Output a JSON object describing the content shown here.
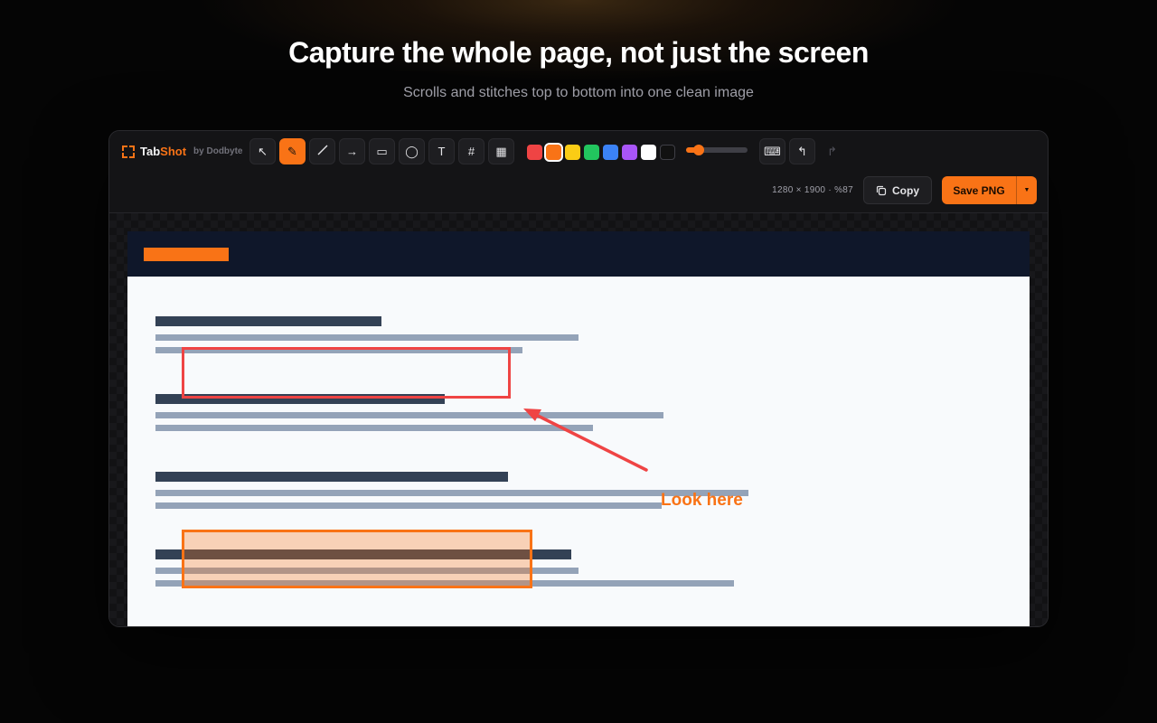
{
  "hero": {
    "title": "Capture the whole page, not just the screen",
    "subtitle": "Scrolls and stitches top to bottom into one clean image"
  },
  "app": {
    "brand": {
      "name_prefix": "Tab",
      "name_accent": "Shot",
      "by": "by Dodbyte",
      "icon": "capture-frame-icon"
    },
    "tools": [
      {
        "name": "select-tool",
        "glyph": "↖",
        "icon": "cursor-icon",
        "active": false
      },
      {
        "name": "pen-tool",
        "glyph": "✎",
        "icon": "pencil-icon",
        "active": true
      },
      {
        "name": "line-tool",
        "glyph": "",
        "icon": "line-icon",
        "active": false
      },
      {
        "name": "arrow-tool",
        "glyph": "→",
        "icon": "arrow-icon",
        "active": false
      },
      {
        "name": "rectangle-tool",
        "glyph": "▭",
        "icon": "rectangle-icon",
        "active": false
      },
      {
        "name": "ellipse-tool",
        "glyph": "◯",
        "icon": "circle-icon",
        "active": false
      },
      {
        "name": "text-tool",
        "glyph": "T",
        "icon": "text-icon",
        "active": false
      },
      {
        "name": "number-tool",
        "glyph": "#",
        "icon": "hash-icon",
        "active": false
      },
      {
        "name": "blur-tool",
        "glyph": "▦",
        "icon": "pixelate-icon",
        "active": false
      }
    ],
    "colors": [
      "#ef4444",
      "#f97316",
      "#facc15",
      "#22c55e",
      "#3b82f6",
      "#a855f7",
      "#ffffff",
      "#111111"
    ],
    "selected_color": "#f97316",
    "stroke_width_level": 0.15,
    "right_tools": [
      {
        "name": "crop-tool",
        "glyph": "⌨",
        "icon": "laptop-icon",
        "disabled": false
      },
      {
        "name": "undo-button",
        "glyph": "↰",
        "icon": "undo-icon",
        "disabled": false
      },
      {
        "name": "redo-button",
        "glyph": "↱",
        "icon": "redo-icon",
        "disabled": true
      }
    ],
    "dimensions_text": "1280 × 1900 · %87",
    "copy_label": "Copy",
    "save_label": "Save PNG",
    "accent": "#f97316"
  },
  "canvas": {
    "annotation_text": "Look here"
  }
}
